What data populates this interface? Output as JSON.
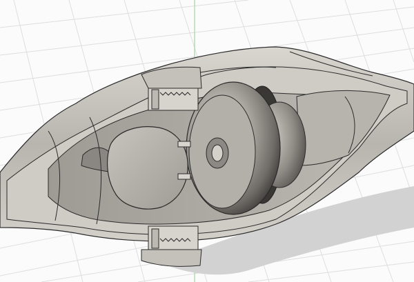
{
  "viewport": {
    "background": "#fbfbfb",
    "grid_color": "#dcdcdc",
    "axis_x_color": "#d98b8b",
    "axis_y_color": "#8fd08f"
  },
  "model": {
    "shell_color": "#a9a6a0",
    "cut_face_color": "#c9c6c0",
    "inner_color": "#8e8b86",
    "edge_color": "#2a2a2a",
    "shadow_color": "#cfcfcf",
    "parts": [
      "outer-shell",
      "section-cut-face",
      "front-lid",
      "sphere-body",
      "rear-cap",
      "spring-top",
      "spring-bottom",
      "funnel-tail"
    ]
  }
}
